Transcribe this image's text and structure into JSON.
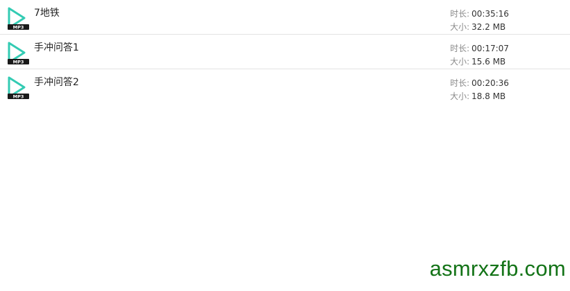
{
  "files": [
    {
      "name": "7地铁",
      "duration_label": "时长:",
      "duration": "00:35:16",
      "size_label": "大小:",
      "size": "32.2 MB",
      "icon": "mp3-play-icon",
      "badge": "MP3"
    },
    {
      "name": "手冲问答1",
      "duration_label": "时长:",
      "duration": "00:17:07",
      "size_label": "大小:",
      "size": "15.6 MB",
      "icon": "mp3-play-icon",
      "badge": "MP3"
    },
    {
      "name": "手冲问答2",
      "duration_label": "时长:",
      "duration": "00:20:36",
      "size_label": "大小:",
      "size": "18.8 MB",
      "icon": "mp3-play-icon",
      "badge": "MP3"
    }
  ],
  "watermark": "asmrxzfb.com",
  "colors": {
    "icon_teal": "#33cbb3",
    "badge_dark": "#1a1a1a",
    "watermark_green": "#137317",
    "divider": "#e3e3e3"
  }
}
